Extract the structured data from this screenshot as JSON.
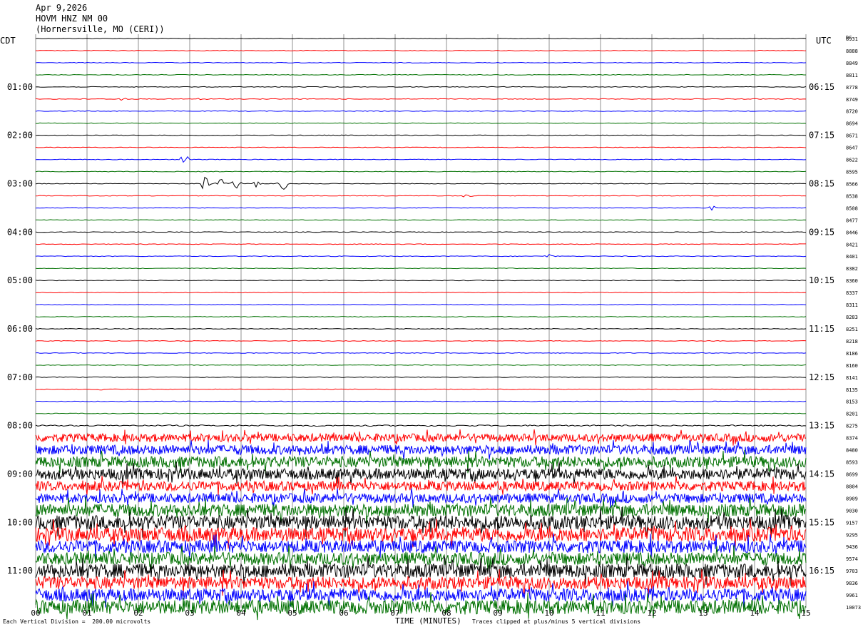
{
  "header": {
    "date": "Apr 9,2026",
    "station": "HOVM HNZ NM 00",
    "location": "(Hornersville, MO (CERI))"
  },
  "labels": {
    "left_zone": "CDT",
    "right_zone": "UTC",
    "dc_label": "DC",
    "xlabel": "TIME (MINUTES)",
    "scale_note": "Each Vertical Division =  200.00 microvolts",
    "clip_note": "Traces clipped at plus/minus 5 vertical divisions"
  },
  "chart_data": {
    "type": "line",
    "title": "",
    "xlabel": "TIME (MINUTES)",
    "xlim": [
      0,
      15
    ],
    "x_ticks": [
      "00",
      "01",
      "02",
      "03",
      "04",
      "05",
      "06",
      "07",
      "08",
      "09",
      "10",
      "11",
      "12",
      "13",
      "14",
      "15"
    ],
    "trace_colors": [
      "#000000",
      "#ff0000",
      "#0000ff",
      "#007000"
    ],
    "left_time_labels": [
      "01:00",
      "02:00",
      "03:00",
      "04:00",
      "05:00",
      "06:00",
      "07:00",
      "08:00",
      "09:00",
      "10:00",
      "11:00"
    ],
    "right_time_labels": [
      "06:15",
      "07:15",
      "08:15",
      "09:15",
      "10:15",
      "11:15",
      "12:15",
      "13:15",
      "14:15",
      "15:15",
      "16:15"
    ],
    "dc_offsets": [
      "8931",
      "8888",
      "8849",
      "8811",
      "8778",
      "8749",
      "8720",
      "8694",
      "8671",
      "8647",
      "8622",
      "8595",
      "8566",
      "8538",
      "8508",
      "8477",
      "8446",
      "8421",
      "8401",
      "8382",
      "8360",
      "8337",
      "8311",
      "8283",
      "8251",
      "8218",
      "8186",
      "8160",
      "8141",
      "8135",
      "8153",
      "8201",
      "8275",
      "8374",
      "8480",
      "8593",
      "8699",
      "8804",
      "8909",
      "9030",
      "9157",
      "9295",
      "9436",
      "9574",
      "9703",
      "9836",
      "9961",
      "10073"
    ],
    "trace_count": 48,
    "minutes_per_trace": 15,
    "noise_level": [
      1,
      1,
      1,
      1,
      1,
      1,
      1,
      1,
      1,
      1,
      1,
      1,
      1,
      1,
      1,
      1,
      1,
      1,
      1,
      1,
      1,
      1,
      1,
      1,
      1,
      1,
      1,
      1,
      1,
      1,
      1,
      1,
      2,
      5,
      6,
      7,
      7,
      6,
      6,
      8,
      9,
      9,
      8,
      8,
      9,
      8,
      8,
      9
    ],
    "events": [
      {
        "trace": 5,
        "minute": 1.7,
        "amplitude": 3
      },
      {
        "trace": 5,
        "minute": 3.25,
        "amplitude": 4
      },
      {
        "trace": 10,
        "minute": 2.9,
        "amplitude": 8
      },
      {
        "trace": 12,
        "minute": 3.3,
        "amplitude": 12
      },
      {
        "trace": 12,
        "minute": 3.6,
        "amplitude": 18
      },
      {
        "trace": 12,
        "minute": 3.9,
        "amplitude": 10
      },
      {
        "trace": 12,
        "minute": 4.3,
        "amplitude": 8
      },
      {
        "trace": 12,
        "minute": 4.8,
        "amplitude": 22
      },
      {
        "trace": 13,
        "minute": 8.4,
        "amplitude": 5
      },
      {
        "trace": 14,
        "minute": 13.2,
        "amplitude": 5
      },
      {
        "trace": 18,
        "minute": 10.0,
        "amplitude": 4
      },
      {
        "trace": 29,
        "minute": 1.3,
        "amplitude": 3
      }
    ]
  }
}
